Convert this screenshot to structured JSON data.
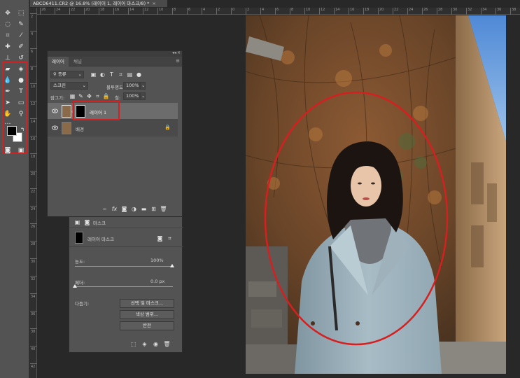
{
  "document": {
    "tab_title": "ABCD6411.CR2 @ 16.8% (레이어 1, 레이어 마스크/8) *",
    "close": "×",
    "ruler_top_marks": [
      "26",
      "24",
      "22",
      "20",
      "18",
      "16",
      "14",
      "12",
      "10",
      "8",
      "6",
      "4",
      "2",
      "0",
      "2",
      "4",
      "6",
      "8",
      "10",
      "12",
      "14",
      "16",
      "18",
      "20",
      "22",
      "24",
      "26",
      "28",
      "30",
      "32",
      "34",
      "36",
      "38"
    ],
    "ruler_left_marks": [
      "2",
      "4",
      "6",
      "8",
      "10",
      "12",
      "14",
      "16",
      "18",
      "20",
      "22",
      "24",
      "26",
      "28",
      "30",
      "32",
      "34",
      "36",
      "38",
      "40",
      "42"
    ]
  },
  "toolbar": {
    "tools": [
      "move-icon",
      "marquee-icon",
      "lasso-icon",
      "quick-select-icon",
      "crop-icon",
      "eyedropper-icon",
      "healing-icon",
      "brush-icon",
      "stamp-icon",
      "history-brush-icon",
      "eraser-icon",
      "paint-bucket-icon",
      "blur-icon",
      "dodge-icon",
      "pen-icon",
      "type-icon",
      "path-select-icon",
      "rectangle-icon",
      "hand-icon",
      "zoom-icon",
      "more-icon",
      "swap-colors-icon",
      "quick-mask-icon",
      "screen-mode-icon"
    ],
    "foreground_color": "#000000",
    "background_color": "#ffffff",
    "highlight_color": "#d42020"
  },
  "layers_panel": {
    "tabs": [
      "레이어",
      "채널"
    ],
    "collapse": "◂◂",
    "close": "×",
    "filter_kind": "종류",
    "blend_mode": "스크린",
    "opacity_label": "불투명도:",
    "opacity_value": "100%",
    "lock_label": "잠그기:",
    "fill_label": "칠:",
    "fill_value": "100%",
    "layers": [
      {
        "name": "레이어 1",
        "visible": true,
        "selected": true,
        "has_mask": true
      },
      {
        "name": "배경",
        "visible": true,
        "selected": false,
        "locked": true
      }
    ],
    "footer_icons": [
      "link-icon",
      "fx-icon",
      "add-mask-icon",
      "adjustment-icon",
      "group-icon",
      "new-layer-icon",
      "delete-icon"
    ],
    "footer_fx": "fx"
  },
  "properties_panel": {
    "mode_label": "마스크",
    "mask_title": "레이어 마스크",
    "density_label": "농도:",
    "density_value": "100%",
    "feather_label": "페더:",
    "feather_value": "0.0 px",
    "refine_label": "다듬기:",
    "buttons": [
      "선택 및 마스크...",
      "색상 범위...",
      "반전"
    ],
    "footer_icons": [
      "load-selection-icon",
      "apply-mask-icon",
      "visibility-icon",
      "delete-icon"
    ]
  },
  "annotations": {
    "ellipse_color": "#d42020"
  }
}
